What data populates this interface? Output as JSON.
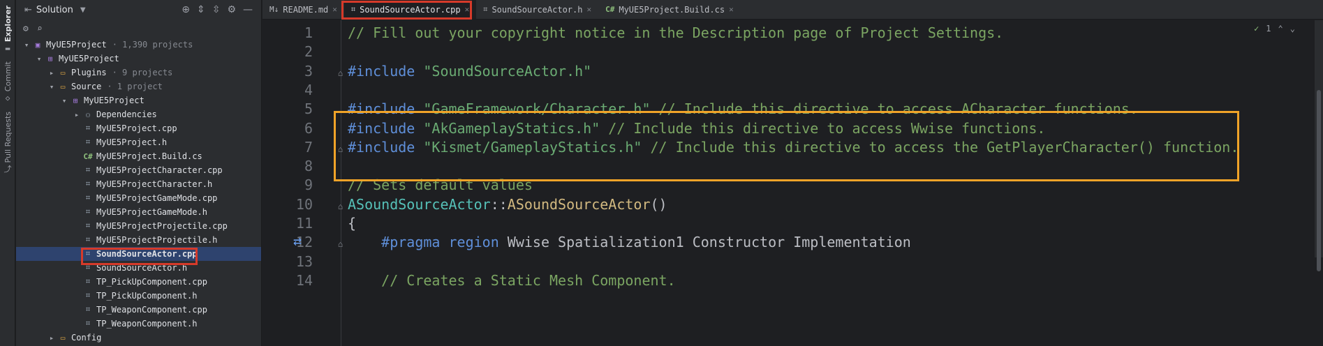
{
  "sidestrip": {
    "explorer_label": "Explorer",
    "commit_label": "Commit",
    "pull_requests_label": "Pull Requests"
  },
  "explorer": {
    "title": "Solution",
    "tree": [
      {
        "label": "MyUE5Project",
        "meta": "· 1,390 projects",
        "icon": "solution-icon",
        "arrow": "▾",
        "depth": 0
      },
      {
        "label": "MyUE5Project",
        "meta": "",
        "icon": "project-icon",
        "arrow": "▾",
        "depth": 1
      },
      {
        "label": "Plugins",
        "meta": "· 9 projects",
        "icon": "folder-icon",
        "arrow": "▸",
        "depth": 2
      },
      {
        "label": "Source",
        "meta": "· 1 project",
        "icon": "folder-icon",
        "arrow": "▾",
        "depth": 2
      },
      {
        "label": "MyUE5Project",
        "meta": "",
        "icon": "project-icon",
        "arrow": "▾",
        "depth": 3
      },
      {
        "label": "Dependencies",
        "meta": "",
        "icon": "dependencies-icon",
        "arrow": "▸",
        "depth": 4
      },
      {
        "label": "MyUE5Project.cpp",
        "meta": "",
        "icon": "cpp-file-icon",
        "arrow": "",
        "depth": 4
      },
      {
        "label": "MyUE5Project.h",
        "meta": "",
        "icon": "header-file-icon",
        "arrow": "",
        "depth": 4
      },
      {
        "label": "MyUE5Project.Build.cs",
        "meta": "",
        "icon": "csharp-file-icon",
        "arrow": "",
        "depth": 4
      },
      {
        "label": "MyUE5ProjectCharacter.cpp",
        "meta": "",
        "icon": "cpp-file-icon",
        "arrow": "",
        "depth": 4
      },
      {
        "label": "MyUE5ProjectCharacter.h",
        "meta": "",
        "icon": "header-file-icon",
        "arrow": "",
        "depth": 4
      },
      {
        "label": "MyUE5ProjectGameMode.cpp",
        "meta": "",
        "icon": "cpp-file-icon",
        "arrow": "",
        "depth": 4
      },
      {
        "label": "MyUE5ProjectGameMode.h",
        "meta": "",
        "icon": "header-file-icon",
        "arrow": "",
        "depth": 4
      },
      {
        "label": "MyUE5ProjectProjectile.cpp",
        "meta": "",
        "icon": "cpp-file-icon",
        "arrow": "",
        "depth": 4
      },
      {
        "label": "MyUE5ProjectProjectile.h",
        "meta": "",
        "icon": "header-file-icon",
        "arrow": "",
        "depth": 4
      },
      {
        "label": "SoundSourceActor.cpp",
        "meta": "",
        "icon": "cpp-file-icon",
        "arrow": "",
        "depth": 4,
        "selected": true
      },
      {
        "label": "SoundSourceActor.h",
        "meta": "",
        "icon": "header-file-icon",
        "arrow": "",
        "depth": 4
      },
      {
        "label": "TP_PickUpComponent.cpp",
        "meta": "",
        "icon": "cpp-file-icon",
        "arrow": "",
        "depth": 4
      },
      {
        "label": "TP_PickUpComponent.h",
        "meta": "",
        "icon": "header-file-icon",
        "arrow": "",
        "depth": 4
      },
      {
        "label": "TP_WeaponComponent.cpp",
        "meta": "",
        "icon": "cpp-file-icon",
        "arrow": "",
        "depth": 4
      },
      {
        "label": "TP_WeaponComponent.h",
        "meta": "",
        "icon": "header-file-icon",
        "arrow": "",
        "depth": 4
      },
      {
        "label": "Config",
        "meta": "",
        "icon": "folder-icon",
        "arrow": "▸",
        "depth": 2
      }
    ]
  },
  "tabs": [
    {
      "label": "README.md",
      "icon": "markdown-icon",
      "active": false
    },
    {
      "label": "SoundSourceActor.cpp",
      "icon": "cpp-file-icon",
      "active": true
    },
    {
      "label": "SoundSourceActor.h",
      "icon": "header-file-icon",
      "active": false
    },
    {
      "label": "MyUE5Project.Build.cs",
      "icon": "csharp-file-icon",
      "active": false
    }
  ],
  "editor": {
    "inspection_count": "1",
    "lines": [
      {
        "n": "1",
        "tokens": [
          [
            "cm",
            "// Fill out your copyright notice in the Description page of Project Settings."
          ]
        ]
      },
      {
        "n": "2",
        "tokens": []
      },
      {
        "n": "3",
        "tokens": [
          [
            "pp",
            "#include"
          ],
          [
            "",
            " "
          ],
          [
            "str",
            "\"SoundSourceActor.h\""
          ]
        ]
      },
      {
        "n": "4",
        "tokens": []
      },
      {
        "n": "5",
        "tokens": [
          [
            "pp",
            "#include"
          ],
          [
            "",
            " "
          ],
          [
            "str",
            "\"GameFramework/Character.h\""
          ],
          [
            "",
            " "
          ],
          [
            "cm",
            "// Include this directive to access ACharacter functions."
          ]
        ]
      },
      {
        "n": "6",
        "tokens": [
          [
            "pp",
            "#include"
          ],
          [
            "",
            " "
          ],
          [
            "str",
            "\"AkGameplayStatics.h\""
          ],
          [
            "",
            " "
          ],
          [
            "cm",
            "// Include this directive to access Wwise functions."
          ]
        ]
      },
      {
        "n": "7",
        "tokens": [
          [
            "pp",
            "#include"
          ],
          [
            "",
            " "
          ],
          [
            "str",
            "\"Kismet/GameplayStatics.h\""
          ],
          [
            "",
            " "
          ],
          [
            "cm",
            "// Include this directive to access the GetPlayerCharacter() function."
          ]
        ]
      },
      {
        "n": "8",
        "tokens": []
      },
      {
        "n": "9",
        "tokens": [
          [
            "cm",
            "// Sets default values"
          ]
        ]
      },
      {
        "n": "10",
        "tokens": [
          [
            "ty",
            "ASoundSourceActor"
          ],
          [
            "",
            "::"
          ],
          [
            "fn",
            "ASoundSourceActor"
          ],
          [
            "",
            "()"
          ]
        ]
      },
      {
        "n": "11",
        "tokens": [
          [
            "",
            "{"
          ]
        ]
      },
      {
        "n": "12",
        "tokens": [
          [
            "",
            "    "
          ],
          [
            "pp",
            "#pragma"
          ],
          [
            "",
            " "
          ],
          [
            "pp",
            "region"
          ],
          [
            "",
            " Wwise Spatialization1 Constructor Implementation"
          ]
        ]
      },
      {
        "n": "13",
        "tokens": []
      },
      {
        "n": "14",
        "tokens": [
          [
            "",
            "    "
          ],
          [
            "cm",
            "// Creates a Static Mesh Component."
          ]
        ]
      }
    ]
  }
}
